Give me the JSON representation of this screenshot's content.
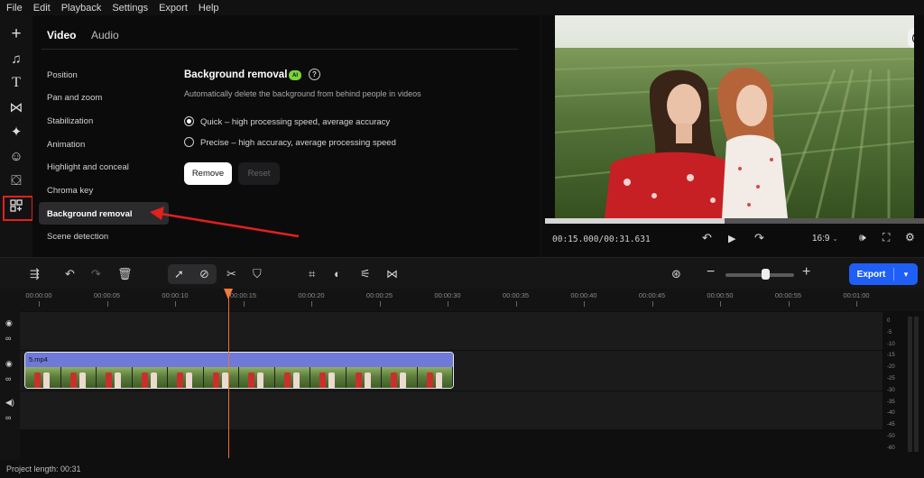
{
  "menu": [
    "File",
    "Edit",
    "Playback",
    "Settings",
    "Export",
    "Help"
  ],
  "tabs": {
    "video": "Video",
    "audio": "Audio"
  },
  "nav": [
    "Position",
    "Pan and zoom",
    "Stabilization",
    "Animation",
    "Highlight and conceal",
    "Chroma key",
    "Background removal",
    "Scene detection"
  ],
  "section": {
    "title": "Background removal",
    "badge": "AI",
    "help": "?",
    "description": "Automatically delete the background from behind people in videos",
    "options": [
      {
        "label": "Quick – high processing speed, average accuracy",
        "selected": true
      },
      {
        "label": "Precise – high accuracy, average processing speed",
        "selected": false
      }
    ],
    "remove_button": "Remove",
    "reset_button": "Reset"
  },
  "preview": {
    "help": "?",
    "timecode": "00:15.000/00:31.631",
    "progress": 0.474,
    "aspect": "16:9"
  },
  "timeline": {
    "export_label": "Export",
    "ruler": [
      "00:00:00",
      "00:00:05",
      "00:00:10",
      "00:00:15",
      "00:00:20",
      "00:00:25",
      "00:00:30",
      "00:00:35",
      "00:00:40",
      "00:00:45",
      "00:00:50",
      "00:00:55",
      "00:01:00"
    ],
    "clip_name": "5.mp4",
    "vu_labels": [
      "0",
      "-5",
      "-10",
      "-15",
      "-20",
      "-25",
      "-30",
      "-35",
      "-40",
      "-45",
      "-50",
      "-60"
    ]
  },
  "status": "Project length: 00:31",
  "colors": {
    "accent": "#1f5ff5",
    "ai_badge": "#7bd33b",
    "annotation": "#e2201e",
    "playhead": "#f07a3a",
    "clip_header": "#6f79d8"
  }
}
